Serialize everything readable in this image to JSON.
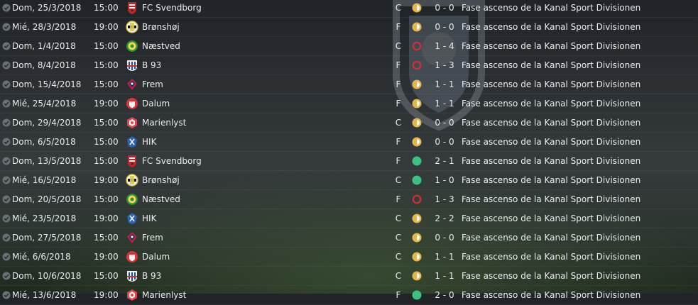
{
  "colors": {
    "win": "#3dc17e",
    "draw": "#e5b44a",
    "loss": "#c8313a"
  },
  "icons": {
    "played": "check-circle-icon",
    "win": "filled-green-circle-icon",
    "draw": "half-filled-circle-icon",
    "loss": "red-ring-icon"
  },
  "fixtures": [
    {
      "date": "Dom, 25/3/2018",
      "time": "15:00",
      "team": "FC Svendborg",
      "crest": "svendborg",
      "venue": "C",
      "result": "draw",
      "score": "0 - 0",
      "competition": "Fase ascenso de la Kanal Sport Divisionen"
    },
    {
      "date": "Mié, 28/3/2018",
      "time": "19:00",
      "team": "Brønshøj",
      "crest": "bronshoj",
      "venue": "F",
      "result": "draw",
      "score": "0 - 0",
      "competition": "Fase ascenso de la Kanal Sport Divisionen"
    },
    {
      "date": "Dom, 1/4/2018",
      "time": "15:00",
      "team": "Næstved",
      "crest": "naestved",
      "venue": "C",
      "result": "loss",
      "score": "1 - 4",
      "competition": "Fase ascenso de la Kanal Sport Divisionen"
    },
    {
      "date": "Dom, 8/4/2018",
      "time": "15:00",
      "team": "B 93",
      "crest": "b93",
      "venue": "F",
      "result": "loss",
      "score": "1 - 3",
      "competition": "Fase ascenso de la Kanal Sport Divisionen"
    },
    {
      "date": "Dom, 15/4/2018",
      "time": "15:00",
      "team": "Frem",
      "crest": "frem",
      "venue": "F",
      "result": "draw",
      "score": "1 - 1",
      "competition": "Fase ascenso de la Kanal Sport Divisionen"
    },
    {
      "date": "Mié, 25/4/2018",
      "time": "19:00",
      "team": "Dalum",
      "crest": "dalum",
      "venue": "F",
      "result": "draw",
      "score": "1 - 1",
      "competition": "Fase ascenso de la Kanal Sport Divisionen"
    },
    {
      "date": "Dom, 29/4/2018",
      "time": "15:00",
      "team": "Marienlyst",
      "crest": "marienlyst",
      "venue": "C",
      "result": "draw",
      "score": "0 - 0",
      "competition": "Fase ascenso de la Kanal Sport Divisionen"
    },
    {
      "date": "Dom, 6/5/2018",
      "time": "15:00",
      "team": "HIK",
      "crest": "hik",
      "venue": "F",
      "result": "draw",
      "score": "0 - 0",
      "competition": "Fase ascenso de la Kanal Sport Divisionen"
    },
    {
      "date": "Dom, 13/5/2018",
      "time": "15:00",
      "team": "FC Svendborg",
      "crest": "svendborg",
      "venue": "F",
      "result": "win",
      "score": "2 - 1",
      "competition": "Fase ascenso de la Kanal Sport Divisionen"
    },
    {
      "date": "Mié, 16/5/2018",
      "time": "19:00",
      "team": "Brønshøj",
      "crest": "bronshoj",
      "venue": "C",
      "result": "win",
      "score": "1 - 0",
      "competition": "Fase ascenso de la Kanal Sport Divisionen"
    },
    {
      "date": "Dom, 20/5/2018",
      "time": "15:00",
      "team": "Næstved",
      "crest": "naestved",
      "venue": "F",
      "result": "loss",
      "score": "1 - 3",
      "competition": "Fase ascenso de la Kanal Sport Divisionen"
    },
    {
      "date": "Mié, 23/5/2018",
      "time": "19:00",
      "team": "HIK",
      "crest": "hik",
      "venue": "C",
      "result": "draw",
      "score": "2 - 2",
      "competition": "Fase ascenso de la Kanal Sport Divisionen"
    },
    {
      "date": "Dom, 27/5/2018",
      "time": "15:00",
      "team": "Frem",
      "crest": "frem",
      "venue": "C",
      "result": "draw",
      "score": "0 - 0",
      "competition": "Fase ascenso de la Kanal Sport Divisionen"
    },
    {
      "date": "Mié, 6/6/2018",
      "time": "19:00",
      "team": "Dalum",
      "crest": "dalum",
      "venue": "C",
      "result": "draw",
      "score": "1 - 1",
      "competition": "Fase ascenso de la Kanal Sport Divisionen"
    },
    {
      "date": "Dom, 10/6/2018",
      "time": "15:00",
      "team": "B 93",
      "crest": "b93",
      "venue": "C",
      "result": "draw",
      "score": "1 - 1",
      "competition": "Fase ascenso de la Kanal Sport Divisionen"
    },
    {
      "date": "Mié, 13/6/2018",
      "time": "19:00",
      "team": "Marienlyst",
      "crest": "marienlyst",
      "venue": "F",
      "result": "win",
      "score": "2 - 0",
      "competition": "Fase ascenso de la Kanal Sport Divisionen"
    }
  ]
}
